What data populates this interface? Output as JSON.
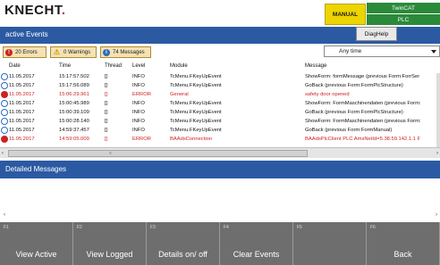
{
  "header": {
    "logo_text": "KNECHT",
    "logo_dot": ".",
    "mode_badge": "MANUAL",
    "runtime_label": "TwinCAT",
    "plc_label": "PLC"
  },
  "toolbar": {
    "title": "active Events",
    "diag_button": "DiagHelp"
  },
  "filters": {
    "errors_label": "20 Errors",
    "warnings_label": "0 Warnings",
    "messages_label": "74 Messages",
    "time_filter_value": "Any time"
  },
  "table": {
    "headers": {
      "date": "Date",
      "time": "Time",
      "thread": "Thread",
      "level": "Level",
      "module": "Module",
      "message": "Message"
    },
    "rows": [
      {
        "date": "11.05.2017",
        "time": "15:17:57.502",
        "thread": "[]",
        "level": "INFO",
        "module": "TcMenu.FKeyUpEvent",
        "message": "ShowForm: formMessage (previous Form:ForrSer",
        "severity": "info"
      },
      {
        "date": "11.05.2017",
        "time": "15:17:56.089",
        "thread": "[]",
        "level": "INFO",
        "module": "TcMenu.FKeyUpEvent",
        "message": "GoBack (previous Form:FormPlcStructure)",
        "severity": "info"
      },
      {
        "date": "11.05.2017",
        "time": "15:06:29.961",
        "thread": "[]",
        "level": "ERROR",
        "module": "General",
        "message": "safety door opened",
        "severity": "error"
      },
      {
        "date": "11.05.2017",
        "time": "15:00:45.989",
        "thread": "[]",
        "level": "INFO",
        "module": "TcMenu.FKeyUpEvent",
        "message": "ShowForm: FormMaschinendaten (previous Form:",
        "severity": "info"
      },
      {
        "date": "11.05.2017",
        "time": "15:00:39.109",
        "thread": "[]",
        "level": "INFO",
        "module": "TcMenu.FKeyUpEvent",
        "message": "GoBack (previous Form:FormPlcStructure)",
        "severity": "info"
      },
      {
        "date": "11.05.2017",
        "time": "15:00:28.140",
        "thread": "[]",
        "level": "INFO",
        "module": "TcMenu.FKeyUpEvent",
        "message": "ShowForm: FormMaschinendaten (previous Form:",
        "severity": "info"
      },
      {
        "date": "11.05.2017",
        "time": "14:59:37.457",
        "thread": "[]",
        "level": "INFO",
        "module": "TcMenu.FKeyUpEvent",
        "message": "GoBack (previous Form:FormManual)",
        "severity": "info"
      },
      {
        "date": "11.05.2017",
        "time": "14:59:05.009",
        "thread": "[]",
        "level": "ERROR",
        "module": "BAAdsConnection",
        "message": "BAAdsPlcClient PLC AmsNetId=5.38.59.142.1.1 F",
        "severity": "error"
      }
    ]
  },
  "details": {
    "title": "Detailed Messages"
  },
  "fkeys": [
    {
      "num": "F1",
      "label": "View Active"
    },
    {
      "num": "F2",
      "label": "View Logged"
    },
    {
      "num": "F3",
      "label": "Details on/ off"
    },
    {
      "num": "F4",
      "label": "Clear Events"
    },
    {
      "num": "F5",
      "label": ""
    },
    {
      "num": "F6",
      "label": "Back"
    }
  ],
  "colors": {
    "header_blue": "#2b5aa3",
    "error_red": "#cc2222",
    "plc_green": "#2a8a3a",
    "manual_yellow": "#ecd500"
  }
}
